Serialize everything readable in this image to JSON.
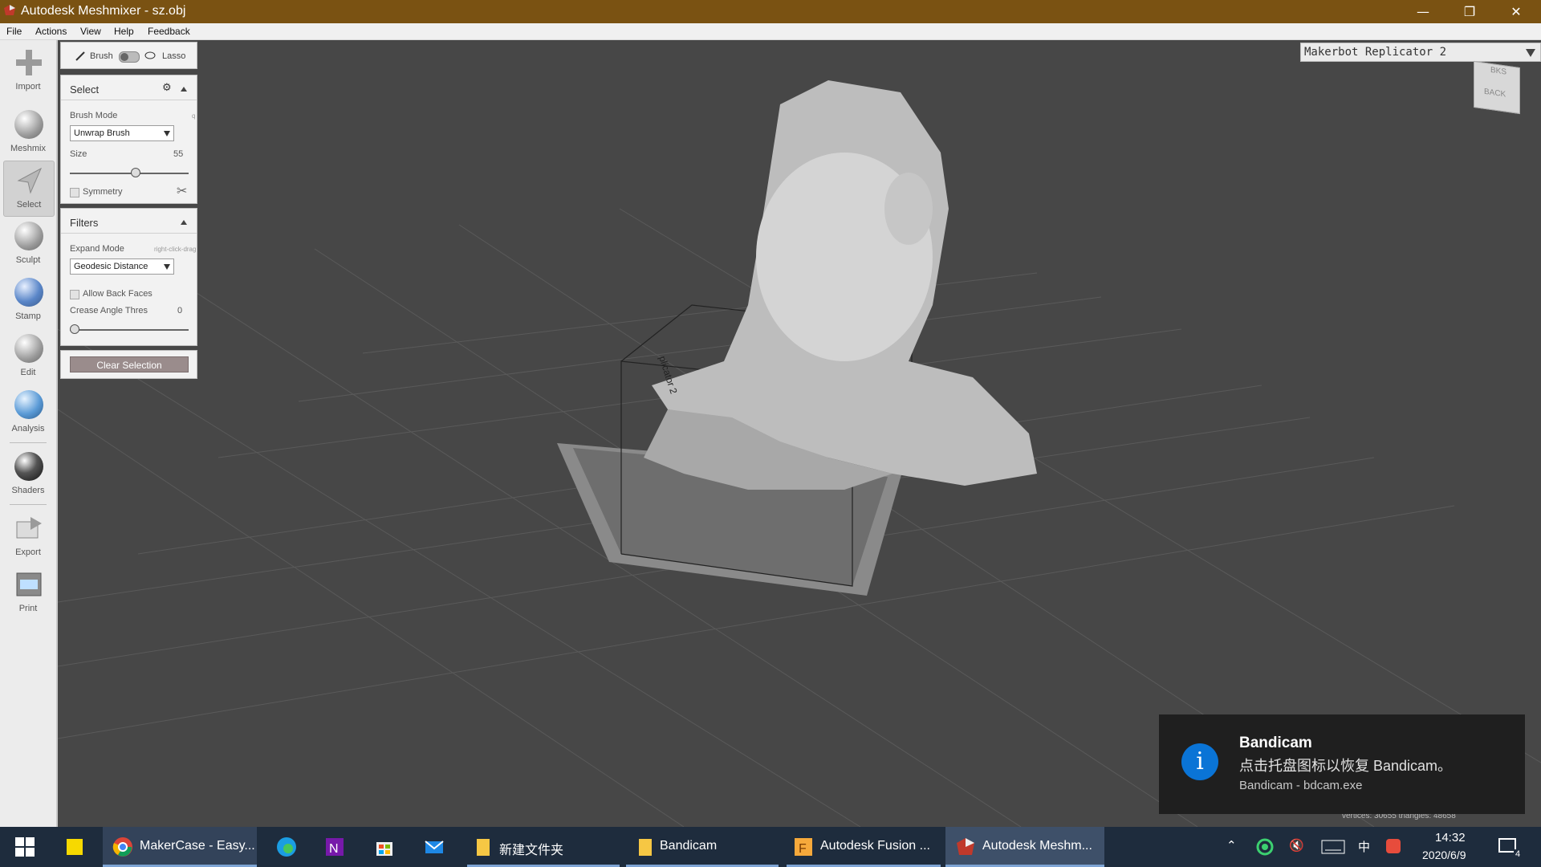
{
  "window": {
    "title": "Autodesk Meshmixer - sz.obj",
    "minimize": "—",
    "restore": "❐",
    "close": "✕"
  },
  "menu": [
    "File",
    "Actions",
    "View",
    "Help",
    "Feedback"
  ],
  "tools": [
    {
      "label": "Import",
      "icon": "plus-icon"
    },
    {
      "label": "Meshmix",
      "icon": "meshmix-sphere-icon"
    },
    {
      "label": "Select",
      "icon": "select-arrow-icon"
    },
    {
      "label": "Sculpt",
      "icon": "sculpt-brush-icon"
    },
    {
      "label": "Stamp",
      "icon": "stamp-icon"
    },
    {
      "label": "Edit",
      "icon": "edit-sphere-icon"
    },
    {
      "label": "Analysis",
      "icon": "analysis-sphere-icon"
    },
    {
      "label": "Shaders",
      "icon": "shader-sphere-icon"
    },
    {
      "label": "Export",
      "icon": "export-icon"
    },
    {
      "label": "Print",
      "icon": "printer-icon"
    }
  ],
  "brush_toggle": {
    "brush": "Brush",
    "lasso": "Lasso"
  },
  "select_panel": {
    "title": "Select",
    "brush_mode_label": "Brush Mode",
    "brush_mode_hint": "q",
    "brush_mode_value": "Unwrap Brush",
    "size_label": "Size",
    "size_value": "55",
    "size_fraction": 0.55,
    "symmetry_label": "Symmetry"
  },
  "filters_panel": {
    "title": "Filters",
    "expand_mode_label": "Expand Mode",
    "expand_mode_hint": "right-click-drag",
    "expand_mode_value": "Geodesic Distance",
    "allow_back_faces_label": "Allow Back Faces",
    "crease_label": "Crease Angle Thres",
    "crease_value": "0",
    "crease_fraction": 0.0
  },
  "clear_selection": "Clear Selection",
  "printer": "Makerbot Replicator 2",
  "build_plate_label": "plicator 2",
  "navcube": {
    "back": "BACK",
    "top": "BKS"
  },
  "stats": "vertices: 30655 triangles: 48658",
  "toast": {
    "title": "Bandicam",
    "message": "点击托盘图标以恢复 Bandicam。",
    "source": "Bandicam - bdcam.exe"
  },
  "taskbar": {
    "apps": [
      {
        "label": "MakerCase - Easy...",
        "icon": "chrome-icon"
      },
      {
        "label": "",
        "icon": "edge-icon"
      },
      {
        "label": "",
        "icon": "onenote-icon"
      },
      {
        "label": "",
        "icon": "store-icon"
      },
      {
        "label": "",
        "icon": "mail-icon"
      },
      {
        "label": "新建文件夹",
        "icon": "folder-icon"
      },
      {
        "label": "Bandicam",
        "icon": "folder-icon"
      },
      {
        "label": "Autodesk Fusion ...",
        "icon": "fusion-icon"
      },
      {
        "label": "Autodesk Meshm...",
        "icon": "meshmixer-icon"
      }
    ],
    "ime": "中",
    "time": "14:32",
    "date": "2020/6/9",
    "notifications": "4"
  }
}
